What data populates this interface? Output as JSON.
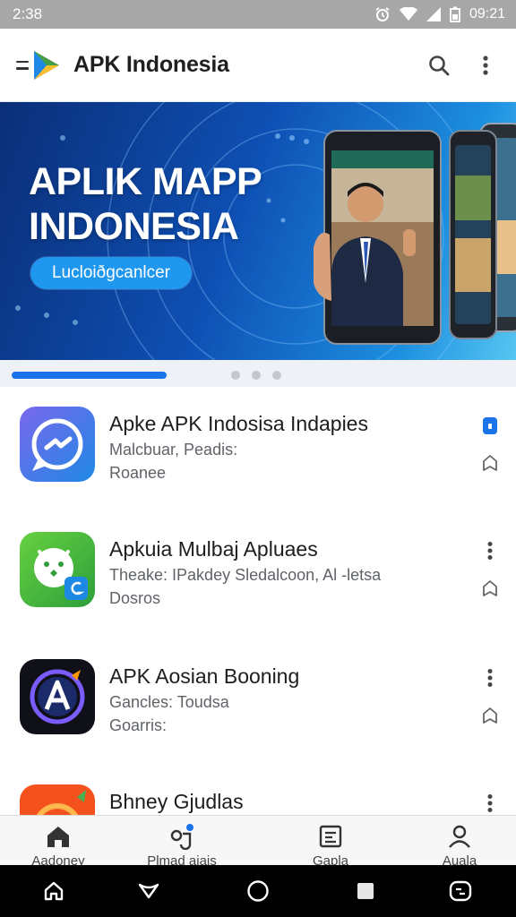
{
  "status_bar": {
    "time": "2:38",
    "clock": "09:21"
  },
  "header": {
    "title": "APK Indonesia"
  },
  "banner": {
    "title_line1": "APLIK MAPP",
    "title_line2": "INDONESIA",
    "button_label": "Lucloiðgcanlcer"
  },
  "apps": [
    {
      "name": "Apke APK Indosisa Indapies",
      "meta1": "Malcbuar, Peadis:",
      "meta2": "Roanee",
      "icon": "messenger-icon"
    },
    {
      "name": "Apkuia Mulbaj Apluaes",
      "meta1": "Theake: IPakdey Sledalcoon, Al -letsa",
      "meta2": "Dosros",
      "icon": "android-icon"
    },
    {
      "name": "APK Aosian Booning",
      "meta1": "Gancles: Toudsa",
      "meta2": "Goarris:",
      "icon": "a-badge-icon"
    },
    {
      "name": "Bhney Gjudlas",
      "icon": "orange-app-icon"
    }
  ],
  "bottom_nav": [
    {
      "label": "Aadoney",
      "icon": "home-icon"
    },
    {
      "label": "Plmad aiais",
      "icon": "apps-icon"
    },
    {
      "label": "Gapla",
      "icon": "news-icon"
    },
    {
      "label": "Auala",
      "icon": "account-icon"
    }
  ],
  "colors": {
    "accent": "#1a73e8",
    "banner_dark": "#0b2f78",
    "banner_light": "#57c6f2",
    "status_bar": "#a7a7a7"
  }
}
